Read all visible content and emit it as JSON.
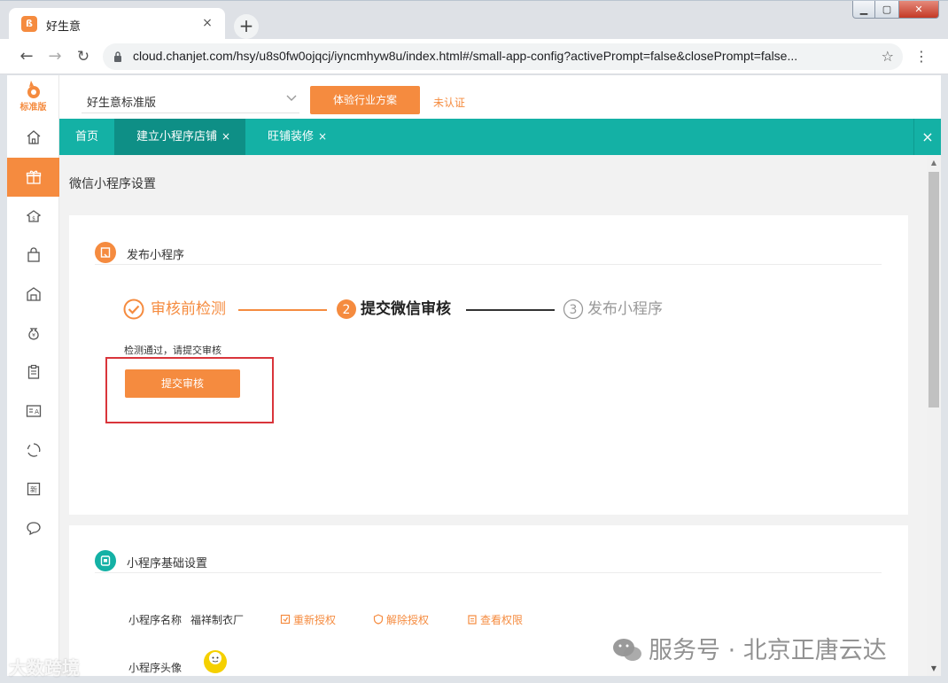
{
  "browser": {
    "tab_title": "好生意",
    "tab_close": "×",
    "new_tab": "+",
    "url": "cloud.chanjet.com/hsy/u8s0fw0ojqcj/iyncmhyw8u/index.html#/small-app-config?activePrompt=false&closePrompt=false..."
  },
  "app": {
    "logo_text": "标准版",
    "shop_name": "好生意标准版",
    "trial_button": "体验行业方案",
    "cert_status": "未认证",
    "tabs": [
      {
        "label": "首页"
      },
      {
        "label": "建立小程序店铺",
        "close": "×"
      },
      {
        "label": "旺铺装修",
        "close": "×"
      }
    ],
    "close_all": "×",
    "page_title": "微信小程序设置",
    "publish": {
      "section_title": "发布小程序",
      "steps": [
        {
          "label": "审核前检测",
          "state": "done"
        },
        {
          "number": "2",
          "label": "提交微信审核",
          "state": "current"
        },
        {
          "number": "3",
          "label": "发布小程序",
          "state": "pending"
        }
      ],
      "check_message": "检测通过，请提交审核",
      "submit_button": "提交审核"
    },
    "basic": {
      "section_title": "小程序基础设置",
      "name_label": "小程序名称",
      "name_value": "福祥制衣厂",
      "links": [
        "重新授权",
        "解除授权",
        "查看权限"
      ],
      "avatar_label": "小程序头像"
    }
  },
  "watermarks": {
    "left": "大数跨境",
    "right": "服务号 · 北京正唐云达"
  },
  "colors": {
    "accent": "#f58b3f",
    "teal": "#14b1a5",
    "teal_active": "#0e8f86",
    "highlight": "#d9353b"
  }
}
